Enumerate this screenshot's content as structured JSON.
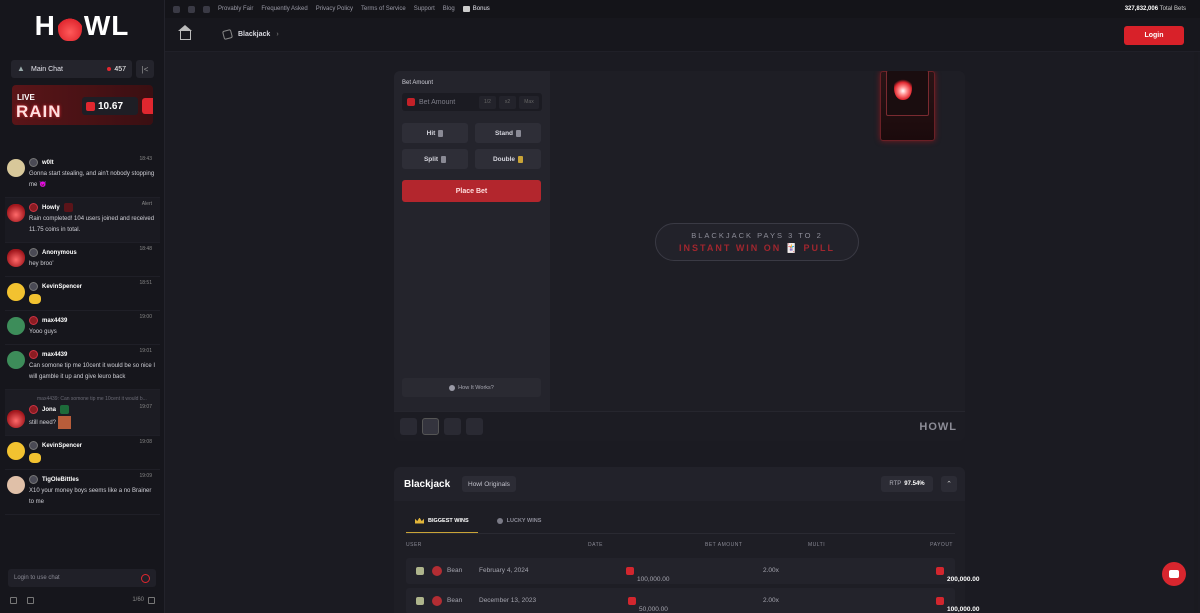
{
  "brand": {
    "logo_left": "H",
    "logo_right": "WL",
    "logo_small": "HOWL"
  },
  "topbar": {
    "links": [
      "Provably Fair",
      "Frequently Asked",
      "Privacy Policy",
      "Terms of Service",
      "Support",
      "Blog"
    ],
    "bonus": "Bonus",
    "total_bets_value": "327,832,006",
    "total_bets_label": "Total Bets"
  },
  "nav": {
    "breadcrumb": "Blackjack",
    "login": "Login"
  },
  "chat": {
    "title": "Main Chat",
    "online": "457",
    "collapse": "|<",
    "rain": {
      "live": "LIVE",
      "word": "RAIN",
      "amount": "10.67"
    },
    "messages": [
      {
        "user": "w0lt",
        "time": "18:43",
        "text": "Gonna start stealing, and ain't nobody stopping me 😈"
      },
      {
        "user": "Howly",
        "time": "Alert",
        "text": "Rain completed! 104 users joined and received 11.75 coins in total."
      },
      {
        "user": "Anonymous",
        "time": "18:48",
        "text": "hey broo'"
      },
      {
        "user": "KevinSpencer",
        "time": "18:51",
        "text": ""
      },
      {
        "user": "max4439",
        "time": "19:00",
        "text": "Yooo guys"
      },
      {
        "user": "max4439",
        "time": "19:01",
        "text": "Can somone tip me 10cent it would be so nice I will gamble it up and give leuro back"
      },
      {
        "user": "Jona",
        "time": "19:07",
        "reply": "max4439: Can somone tip me 10cent it would b...",
        "text": "still need?"
      },
      {
        "user": "KevinSpencer",
        "time": "19:08",
        "text": ""
      },
      {
        "user": "TigOleBittles",
        "time": "19:09",
        "text": "X10 your money boys seems like a no Brainer to me"
      }
    ],
    "input_placeholder": "Login to use chat",
    "footer_count": "1/60"
  },
  "game": {
    "bet_label": "Bet Amount",
    "bet_placeholder": "Bet Amount",
    "quick": [
      "1/2",
      "x2",
      "Max"
    ],
    "hit": "Hit",
    "stand": "Stand",
    "split": "Split",
    "double": "Double",
    "place_bet": "Place Bet",
    "how_it_works": "How It Works?",
    "pays_line1": "BLACKJACK PAYS 3 TO 2",
    "pays_line2": "INSTANT WIN ON 🃏 PULL"
  },
  "info": {
    "title": "Blackjack",
    "badge": "Howl Originals",
    "rtp_label": "RTP",
    "rtp_value": "97.54%",
    "tabs": [
      "BIGGEST WINS",
      "LUCKY WINS"
    ],
    "columns": [
      "USER",
      "DATE",
      "BET AMOUNT",
      "MULTI",
      "PAYOUT"
    ],
    "rows": [
      {
        "user": "Bean",
        "date": "February 4, 2024",
        "bet": "100,000.00",
        "multi": "2.00x",
        "payout": "200,000.00"
      },
      {
        "user": "Bean",
        "date": "December 13, 2023",
        "bet": "50,000.00",
        "multi": "2.00x",
        "payout": "100,000.00"
      }
    ]
  },
  "colors": {
    "accent": "#d82129",
    "bg": "#1b1b22",
    "panel": "#24242c",
    "gold": "#e2b53a"
  }
}
